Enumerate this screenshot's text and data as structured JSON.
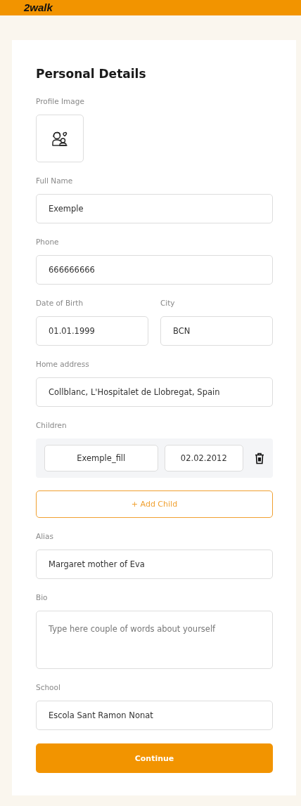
{
  "header": {
    "logo": "2walk"
  },
  "form": {
    "title": "Personal Details",
    "profile_image_label": "Profile Image",
    "fields": [
      {
        "kind": "text",
        "label": "Full Name",
        "value": "Exemple"
      },
      {
        "kind": "text",
        "label": "Phone",
        "value": "666666666"
      },
      {
        "kind": "pair",
        "items": [
          {
            "label": "Date of Birth",
            "value": "01.01.1999"
          },
          {
            "label": "City",
            "value": "BCN"
          }
        ]
      },
      {
        "kind": "text",
        "label": "Home address",
        "value": "Collblanc, L'Hospitalet de Llobregat, Spain"
      },
      {
        "kind": "children",
        "label": "Children",
        "children": [
          {
            "name": "Exemple_fill",
            "birth_date": "02.02.2012"
          }
        ],
        "add_button": "+ Add Child"
      },
      {
        "kind": "text",
        "label": "Alias",
        "value": "Margaret mother of Eva"
      },
      {
        "kind": "textarea",
        "label": "Bio",
        "placeholder": "Type here couple of words about yourself"
      },
      {
        "kind": "text",
        "label": "School",
        "value": "Escola Sant Ramon Nonat"
      }
    ],
    "submit": "Continue"
  }
}
